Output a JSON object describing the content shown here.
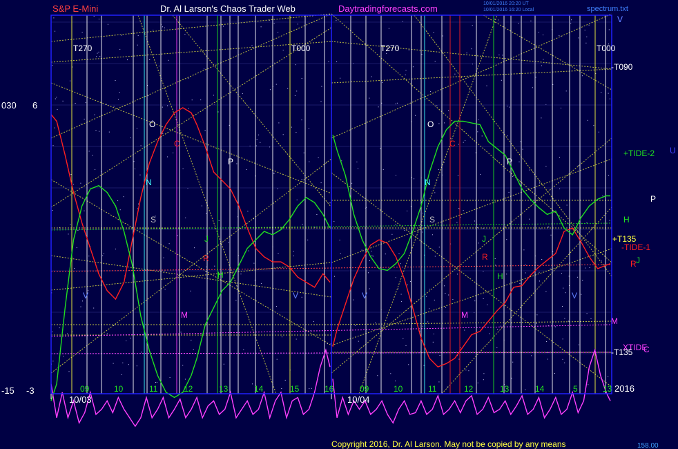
{
  "header": {
    "symbol": "S&P E-Mini",
    "title": "Dr. Al Larson's Chaos Trader Web",
    "site": "Daytradingforecasts.com",
    "stamp1": "10/01/2016 20:20 UT",
    "stamp2": "10/01/2016 16:20 Local",
    "file": "spectrum.txt"
  },
  "left_axis": [
    "030",
    "6",
    "-15",
    "-3"
  ],
  "footer": {
    "copyright": "Copyright 2016, Dr. Al Larson. May not be copied by any means",
    "readout": "158.00",
    "year": "2016"
  },
  "colors": {
    "background": "#000044",
    "border": "#2020ff",
    "price": "#ff2020",
    "forecast": "#20e020",
    "spectrum": "#ff40ff",
    "trend": "#e0e040",
    "vline_white": "#ffffff",
    "vline_yellow": "#ffff40",
    "vline_green": "#20e020",
    "vline_red": "#ff2020",
    "vline_magenta": "#ff40ff",
    "vline_blue": "#6080ff",
    "vline_cyan": "#40ffff"
  },
  "chart_data": {
    "type": "line",
    "days": [
      "10/03",
      "10/04"
    ],
    "hour_labels": [
      [
        "09",
        "10",
        "11",
        "12",
        "13",
        "14",
        "15",
        "16"
      ],
      [
        "09",
        "10",
        "11",
        "12",
        "13",
        "14",
        "5",
        "13"
      ]
    ],
    "top_labels": [
      [
        "T270",
        "T000"
      ],
      [
        "T270",
        "T000",
        "V"
      ]
    ],
    "right_labels": [
      {
        "text": "-T090",
        "color": "#ffffff"
      },
      {
        "text": "+TIDE-2",
        "color": "#20e020"
      },
      {
        "text": "U",
        "color": "#4040ff"
      },
      {
        "text": "P",
        "color": "#ffffff"
      },
      {
        "text": "H",
        "color": "#20e020"
      },
      {
        "text": "+T135",
        "color": "#ffff40"
      },
      {
        "text": "-TIDE-1",
        "color": "#ff2020"
      },
      {
        "text": "R",
        "color": "#ff2020"
      },
      {
        "text": "J",
        "color": "#20e020"
      },
      {
        "text": "M",
        "color": "#ff40ff"
      },
      {
        "text": "XTIDE",
        "color": "#ff40ff"
      },
      {
        "text": "-T135",
        "color": "#ffffff"
      },
      {
        "text": "C",
        "color": "#ff40ff"
      }
    ],
    "markers": [
      {
        "text": "O",
        "color": "#ffffff"
      },
      {
        "text": "C",
        "color": "#ff2020"
      },
      {
        "text": "P",
        "color": "#ffffff"
      },
      {
        "text": "N",
        "color": "#40ffff"
      },
      {
        "text": "S",
        "color": "#c0c0c0"
      },
      {
        "text": "J",
        "color": "#20e020"
      },
      {
        "text": "R",
        "color": "#ff2020"
      },
      {
        "text": "H",
        "color": "#20e020"
      },
      {
        "text": "M",
        "color": "#ff40ff"
      },
      {
        "text": "V",
        "color": "#6080ff"
      },
      {
        "text": "V",
        "color": "#6080ff"
      },
      {
        "text": "O",
        "color": "#ffffff"
      },
      {
        "text": "C",
        "color": "#ff2020"
      },
      {
        "text": "P",
        "color": "#ffffff"
      },
      {
        "text": "N",
        "color": "#40ffff"
      },
      {
        "text": "S",
        "color": "#c0c0c0"
      },
      {
        "text": "J",
        "color": "#20e020"
      },
      {
        "text": "R",
        "color": "#ff2020"
      },
      {
        "text": "H",
        "color": "#20e020"
      },
      {
        "text": "M",
        "color": "#ff40ff"
      },
      {
        "text": "V",
        "color": "#6080ff"
      },
      {
        "text": "V",
        "color": "#6080ff"
      },
      {
        "text": "V",
        "color": "#6080ff"
      }
    ],
    "series": [
      {
        "name": "price",
        "color": "#ff2020",
        "x": [
          0,
          2,
          5,
          8,
          11,
          14,
          17,
          20,
          23,
          26,
          29,
          32,
          35,
          38,
          41,
          44,
          47,
          50,
          52,
          55,
          58,
          61,
          64,
          67,
          70,
          73,
          76,
          79,
          82,
          85,
          88,
          91,
          94,
          97,
          99.5,
          100.5,
          102,
          105,
          108,
          111,
          114,
          117,
          120,
          123,
          126,
          129,
          132,
          135,
          138,
          141,
          144,
          147,
          150,
          153,
          156,
          159,
          162,
          165,
          168,
          171,
          174,
          177,
          180,
          183,
          186,
          189,
          192,
          195,
          198,
          199.5
        ],
        "y": [
          5.4,
          5.0,
          3.0,
          0.8,
          -1.0,
          -2.5,
          -4.0,
          -5.0,
          -5.5,
          -4.5,
          -2.0,
          0.5,
          2.5,
          3.8,
          4.8,
          5.5,
          5.8,
          5.5,
          4.8,
          3.5,
          2.0,
          1.5,
          1.0,
          0.0,
          -1.3,
          -2.5,
          -3.0,
          -3.3,
          -3.3,
          -3.6,
          -4.2,
          -4.5,
          -4.8,
          -4.0,
          -4.5,
          -8.3,
          -7.3,
          -5.8,
          -4.3,
          -3.2,
          -2.3,
          -2.0,
          -2.2,
          -3.0,
          -4.3,
          -6.0,
          -7.8,
          -9.0,
          -9.5,
          -9.3,
          -9.0,
          -8.3,
          -7.6,
          -7.4,
          -6.8,
          -6.2,
          -5.7,
          -4.8,
          -4.7,
          -4.1,
          -3.6,
          -3.2,
          -2.8,
          -1.5,
          -1.3,
          -2.1,
          -3.0,
          -3.7,
          -3.5,
          -3.4
        ]
      },
      {
        "name": "forecast",
        "color": "#20e020",
        "x": [
          0,
          2,
          5,
          8,
          11,
          14,
          17,
          20,
          23,
          26,
          29,
          32,
          35,
          38,
          41,
          44,
          47,
          50,
          52,
          55,
          58,
          61,
          64,
          67,
          70,
          73,
          76,
          79,
          82,
          85,
          88,
          91,
          94,
          97,
          99.5,
          100.5,
          102,
          105,
          108,
          111,
          114,
          117,
          120,
          123,
          126,
          129,
          132,
          135,
          138,
          141,
          144,
          147,
          150,
          153,
          156,
          159,
          162,
          165,
          168,
          171,
          174,
          177,
          180,
          183,
          186,
          189,
          192,
          195,
          198,
          199.5
        ],
        "y": [
          -11.5,
          -10.5,
          -6.0,
          -2.0,
          0.0,
          1.0,
          1.2,
          0.8,
          0.0,
          -1.5,
          -3.5,
          -6.5,
          -8.5,
          -10.0,
          -11.0,
          -11.3,
          -11.0,
          -10.0,
          -9.0,
          -7.0,
          -6.0,
          -5.0,
          -4.5,
          -3.5,
          -2.5,
          -2.0,
          -1.5,
          -1.7,
          -1.4,
          -0.8,
          0.0,
          0.5,
          0.2,
          -0.5,
          -1.3,
          4.2,
          3.3,
          1.8,
          -0.5,
          -2.0,
          -3.0,
          -3.7,
          -3.8,
          -3.4,
          -2.8,
          -1.5,
          0.0,
          2.0,
          3.5,
          4.5,
          5.0,
          5.0,
          4.9,
          4.8,
          3.8,
          3.4,
          3.0,
          2.0,
          1.0,
          0.4,
          -0.1,
          -0.5,
          -0.3,
          -1.3,
          -1.7,
          -0.7,
          0.0,
          0.4,
          0.6,
          0.6
        ]
      },
      {
        "name": "spectrum",
        "color": "#ff40ff",
        "x": [
          0,
          2,
          4,
          6,
          8,
          10,
          12,
          14,
          16,
          18,
          20,
          22,
          24,
          26,
          28,
          30,
          32,
          34,
          36,
          38,
          40,
          42,
          44,
          46,
          48,
          50,
          52,
          54,
          56,
          58,
          60,
          62,
          64,
          66,
          68,
          70,
          72,
          74,
          76,
          78,
          80,
          82,
          84,
          86,
          88,
          90,
          92,
          94,
          96,
          98,
          99.5,
          100.5,
          102,
          104,
          106,
          108,
          110,
          112,
          114,
          116,
          118,
          120,
          122,
          124,
          126,
          128,
          130,
          132,
          134,
          136,
          138,
          140,
          142,
          144,
          146,
          148,
          150,
          152,
          154,
          156,
          158,
          160,
          162,
          164,
          166,
          168,
          170,
          172,
          174,
          176,
          178,
          180,
          182,
          184,
          186,
          188,
          190,
          192,
          194,
          196,
          198,
          199.5
        ],
        "y": [
          -10.5,
          -12.5,
          -11.0,
          -12.5,
          -11.5,
          -12.8,
          -12.2,
          -11.0,
          -12.3,
          -12.0,
          -11.5,
          -12.2,
          -11.3,
          -12.0,
          -12.5,
          -13.0,
          -12.5,
          -11.3,
          -12.5,
          -12.0,
          -11.3,
          -12.5,
          -12.0,
          -11.4,
          -12.5,
          -12.0,
          -11.3,
          -12.5,
          -11.8,
          -11.5,
          -12.3,
          -12.0,
          -11.0,
          -12.5,
          -12.0,
          -11.5,
          -12.3,
          -12.0,
          -11.0,
          -12.5,
          -11.5,
          -11.0,
          -12.5,
          -11.5,
          -11.3,
          -12.3,
          -12.0,
          -11.0,
          -9.5,
          -8.5,
          -9.5,
          -10.2,
          -12.5,
          -11.3,
          -12.3,
          -11.5,
          -12.0,
          -11.5,
          -12.3,
          -12.0,
          -11.5,
          -12.3,
          -12.8,
          -12.0,
          -11.5,
          -12.3,
          -12.2,
          -11.5,
          -12.3,
          -12.0,
          -11.2,
          -12.3,
          -12.0,
          -11.5,
          -12.2,
          -11.5,
          -11.2,
          -12.3,
          -12.0,
          -11.3,
          -12.2,
          -12.0,
          -11.5,
          -12.3,
          -11.8,
          -11.2,
          -12.3,
          -12.0,
          -11.3,
          -12.5,
          -12.0,
          -11.3,
          -12.3,
          -12.0,
          -11.0,
          -12.2,
          -11.5,
          -9.5,
          -8.5,
          -10.0,
          -11.0,
          -11.5
        ]
      }
    ]
  }
}
